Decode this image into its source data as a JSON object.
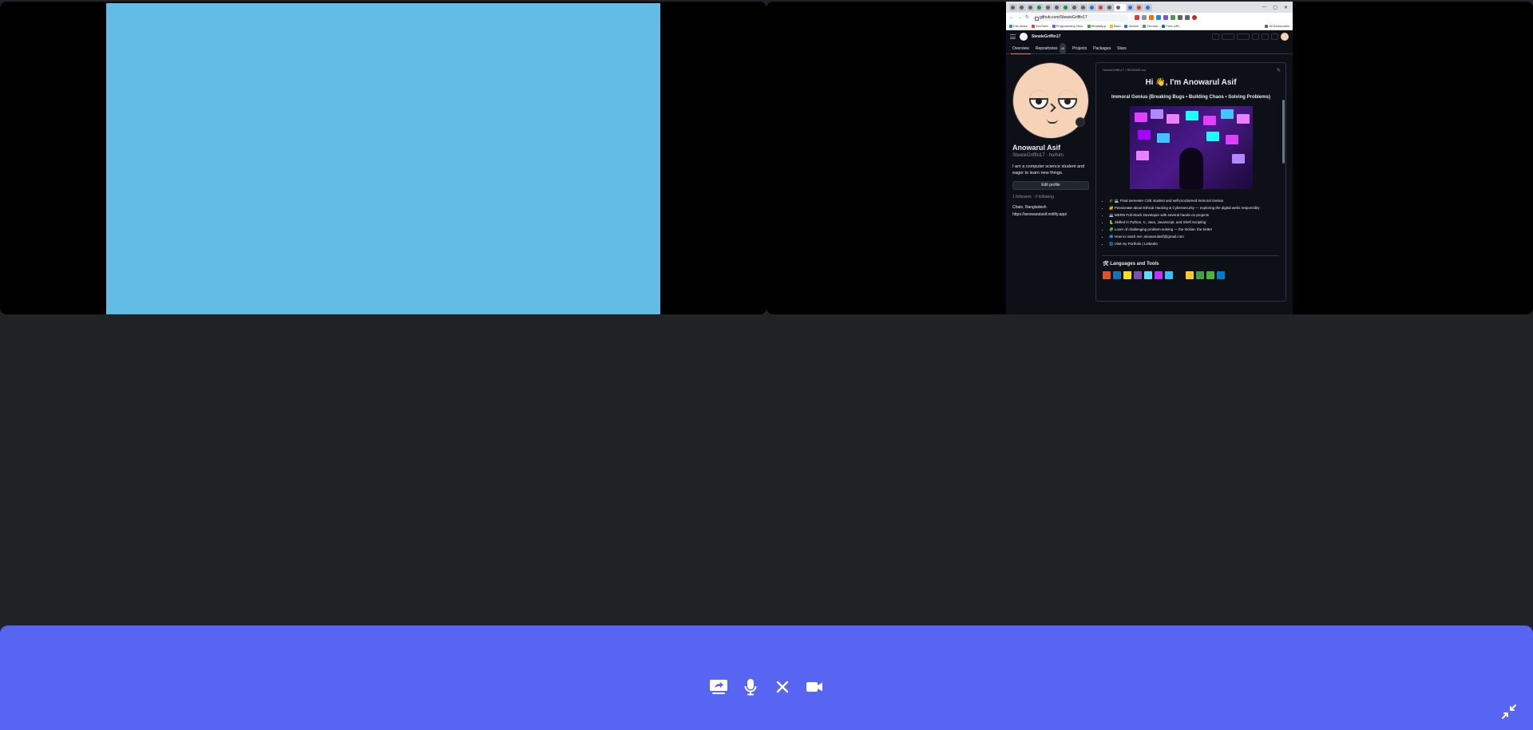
{
  "browser": {
    "url": "github.com/StewieGriffin17",
    "bookmarks": [
      "Fair share",
      "YouTube",
      "Programming Hero",
      "WhatsApp",
      "Bard",
      "Gemini",
      "Chrome",
      "Free URL",
      "All Bookmarks"
    ],
    "window_controls": [
      "—",
      "▢",
      "✕"
    ]
  },
  "github": {
    "header_user": "StewieGriffin17",
    "tabs": [
      {
        "label": "Overview"
      },
      {
        "label": "Repositories",
        "count": "40"
      },
      {
        "label": "Projects"
      },
      {
        "label": "Packages"
      },
      {
        "label": "Stars"
      }
    ],
    "profile": {
      "name": "Anowarul Asif",
      "handle": "StewieGriffin17 · he/him",
      "bio": "I am a computer science student and eager to learn new things.",
      "edit_button": "Edit profile",
      "followers": "1 followers · 0 following",
      "location": "Chato, Bangladesh",
      "website": "https://anowarulasif.netlify.app/"
    },
    "readme": {
      "path": "StewieGriffin17 / README.md",
      "title": "Hi 👋, I'm Anowarul Asif",
      "subtitle": "Immoral Genius (Breaking Bugs • Building Chaos • Solving Problems)",
      "bullets": [
        "🎓 💻 Final semester CSE student and self-proclaimed Immoral Genius",
        "🔐 Passionate about Ethical Hacking & Cybersecurity — exploring the digital webs responsibly",
        "💻 MERN Full-Stack Developer with several hands-on projects",
        "🐍 Skilled in Python, C, Java, JavaScript, and Shell Scripting",
        "🧩 Lover of challenging problem-solving — the trickier, the better",
        "📫 How to reach me: anowarulasif@gmail.com",
        "🌐 Visit my Portfolio | LinkedIn"
      ],
      "languages_heading": "🛠 Languages and Tools"
    }
  },
  "controls": {
    "share_screen": "share-screen-icon",
    "microphone": "microphone-icon",
    "leave": "close-icon",
    "camera": "camera-icon",
    "minimize": "minimize-icon"
  },
  "colors": {
    "background": "#202225",
    "control_bar": "#5865f2",
    "tile_bg": "#000000",
    "video_blue": "#63bce6"
  }
}
